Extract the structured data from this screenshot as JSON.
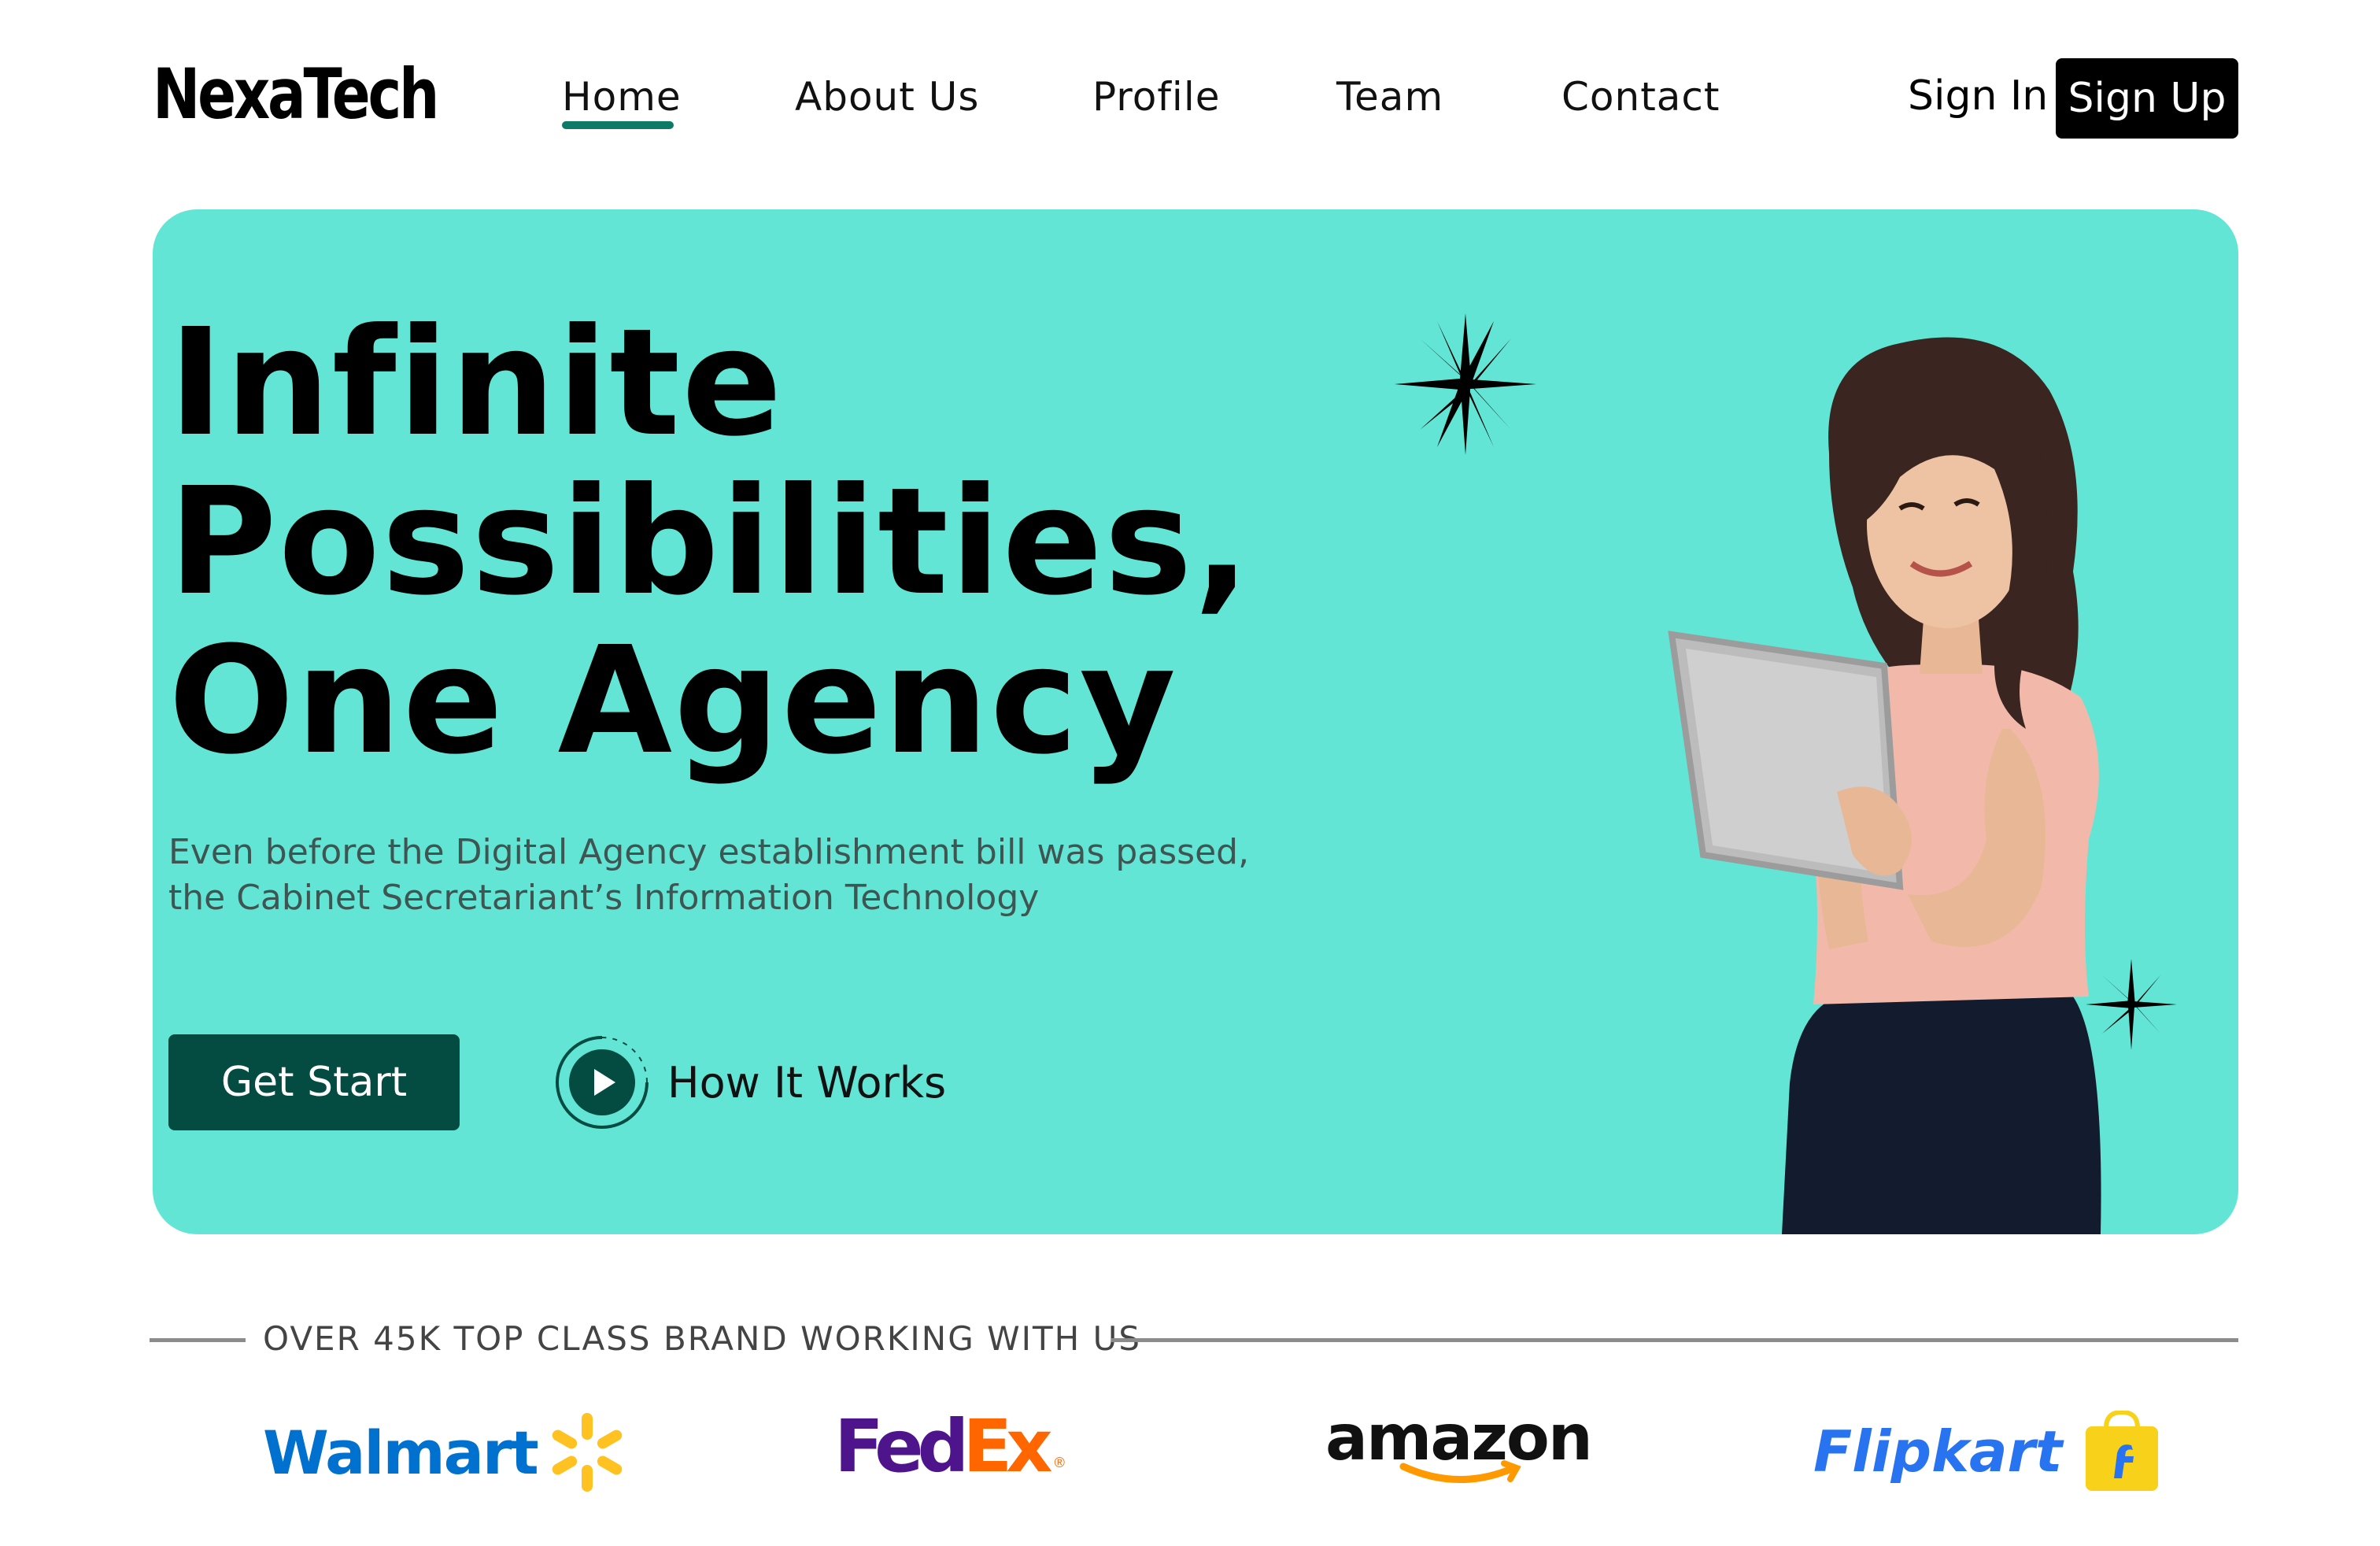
{
  "brand": {
    "logo": "NexaTech"
  },
  "nav": {
    "links": [
      {
        "label": "Home",
        "active": true
      },
      {
        "label": "About Us"
      },
      {
        "label": "Profile"
      },
      {
        "label": "Team"
      },
      {
        "label": "Contact"
      }
    ],
    "sign_in": "Sign In",
    "sign_up": "Sign Up"
  },
  "hero": {
    "headline_lines": [
      "Infinite",
      "Possibilities,",
      "One Agency"
    ],
    "subtext_lines": [
      "Even before the Digital Agency establishment bill was passed,",
      "the Cabinet Secretariant’s Information Technology"
    ],
    "primary_button": "Get Start",
    "secondary_button": "How It Works"
  },
  "brands": {
    "title": "OVER 45K TOP CLASS BRAND WORKING WITH US",
    "logos": [
      {
        "name": "Walmart"
      },
      {
        "name": "FedEx",
        "parts": [
          "Fed",
          "Ex"
        ]
      },
      {
        "name": "amazon"
      },
      {
        "name": "Flipkart"
      }
    ]
  },
  "colors": {
    "accent": "#63e5d5",
    "primary_button_bg": "#044c42",
    "underline": "#0c7a66",
    "walmart_blue": "#0071ce",
    "walmart_yellow": "#ffc220",
    "fedex_purple": "#4d148c",
    "fedex_orange": "#ff6600",
    "amazon_orange": "#ff9900",
    "flipkart_blue": "#2874f0",
    "flipkart_yellow": "#f8d21a"
  }
}
